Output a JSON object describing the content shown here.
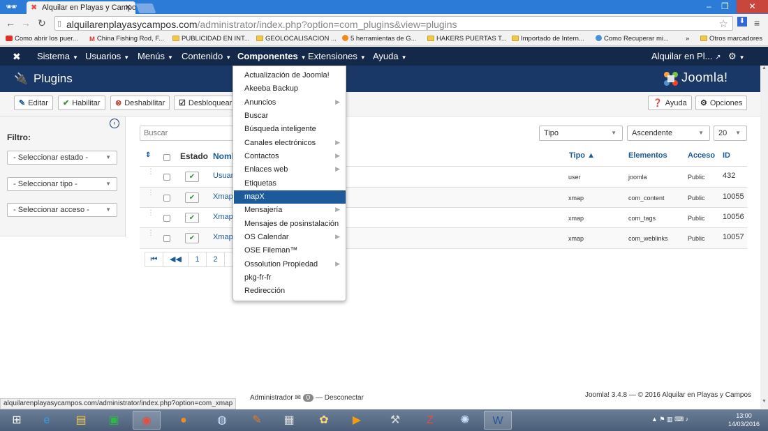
{
  "browser": {
    "tab_title": "Alquilar en Playas y Campo",
    "url_host": "alquilarenplayasycampos.com",
    "url_path": "/administrator/index.php?option=com_plugins&view=plugins",
    "status_url": "alquilarenplayasycampos.com/administrator/index.php?option=com_xmap",
    "bookmarks": [
      "Como abrir los puer...",
      "China Fishing Rod, F...",
      "PUBLICIDAD EN INT...",
      "GEOLOCALISACION ...",
      "5 herramientas de G...",
      "HAKERS PUERTAS T...",
      "Importado de Intern...",
      "Como Recuperar mi...",
      "»",
      "Otros marcadores"
    ]
  },
  "topnav": {
    "items": [
      "Sistema",
      "Usuarios",
      "Menús",
      "Contenido",
      "Componentes",
      "Extensiones",
      "Ayuda"
    ],
    "site_link": "Alquilar en Pl..."
  },
  "header": {
    "title": "Plugins",
    "logo_text": "Joomla!"
  },
  "toolbar": {
    "edit": "Editar",
    "enable": "Habilitar",
    "disable": "Deshabilitar",
    "unlock": "Desbloquear",
    "help": "Ayuda",
    "options": "Opciones"
  },
  "sidebar": {
    "filter_label": "Filtro:",
    "state": "- Seleccionar estado -",
    "type": "- Seleccionar tipo -",
    "access": "- Seleccionar acceso -"
  },
  "filters": {
    "search_placeholder": "Buscar",
    "type": "Tipo",
    "order": "Ascendente",
    "limit": "20"
  },
  "table": {
    "headers": {
      "state": "Estado",
      "name": "Nomb",
      "type": "Tipo ▲",
      "element": "Elementos",
      "access": "Acceso",
      "id": "ID"
    },
    "rows": [
      {
        "name": "Usuar",
        "type": "user",
        "element": "joomla",
        "access": "Public",
        "id": "432"
      },
      {
        "name": "Xmap",
        "type": "xmap",
        "element": "com_content",
        "access": "Public",
        "id": "10055"
      },
      {
        "name": "Xmap",
        "type": "xmap",
        "element": "com_tags",
        "access": "Public",
        "id": "10056"
      },
      {
        "name": "Xmap",
        "type": "xmap",
        "element": "com_weblinks",
        "access": "Public",
        "id": "10057"
      }
    ]
  },
  "pagination": [
    "1",
    "2"
  ],
  "dropdown": {
    "items": [
      {
        "label": "Actualización de Joomla!"
      },
      {
        "label": "Akeeba Backup"
      },
      {
        "label": "Anuncios",
        "sub": true
      },
      {
        "label": "Buscar"
      },
      {
        "label": "Búsqueda inteligente"
      },
      {
        "label": "Canales electrónicos",
        "sub": true
      },
      {
        "label": "Contactos",
        "sub": true
      },
      {
        "label": "Enlaces web",
        "sub": true
      },
      {
        "label": "Etiquetas"
      },
      {
        "label": "mapX",
        "active": true
      },
      {
        "label": "Mensajería",
        "sub": true
      },
      {
        "label": "Mensajes de posinstalación"
      },
      {
        "label": "OS Calendar",
        "sub": true
      },
      {
        "label": "OSE Fileman™"
      },
      {
        "label": "Ossolution Propiedad",
        "sub": true
      },
      {
        "label": "pkg-fr-fr"
      },
      {
        "label": "Redirección"
      }
    ]
  },
  "footer": {
    "admin": "Administrador",
    "messages": "0",
    "logout": "Desconectar",
    "copyright": "Joomla! 3.4.8 — © 2016 Alquilar en Playas y Campos"
  },
  "taskbar": {
    "time": "13:00",
    "date": "14/03/2016"
  },
  "colors": {
    "topnav_bg": "#142849",
    "header_bg": "#1a3867",
    "active_item": "#1c5a9c"
  }
}
